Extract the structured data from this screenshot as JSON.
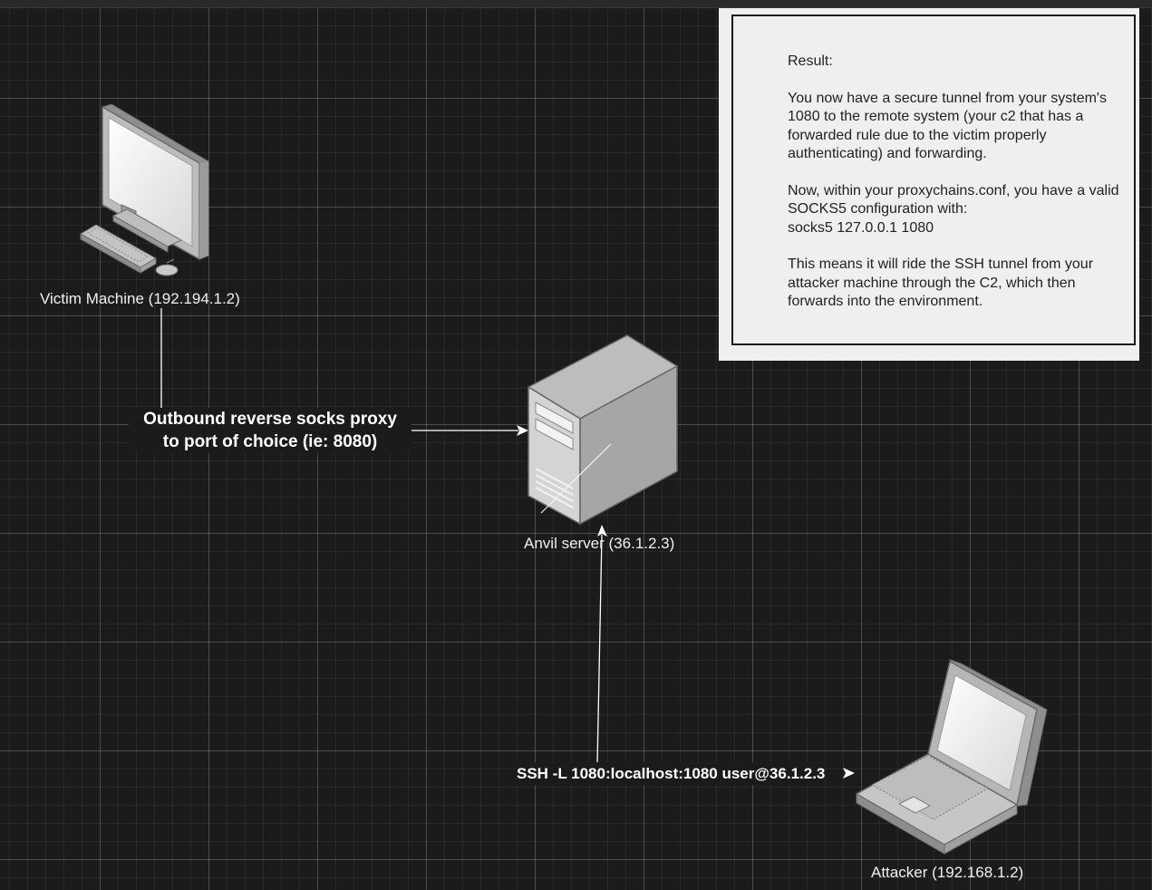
{
  "nodes": {
    "victim": {
      "label": "Victim Machine (192.194.1.2)"
    },
    "server": {
      "label": "Anvil server (36.1.2.3)"
    },
    "attacker": {
      "label": "Attacker (192.168.1.2)"
    }
  },
  "edges": {
    "victim_to_server": {
      "line1": "Outbound reverse socks proxy",
      "line2": "to port of choice (ie: 8080)"
    },
    "attacker_to_server": {
      "label": "SSH -L 1080:localhost:1080 user@36.1.2.3"
    }
  },
  "note": {
    "p1": "Result:",
    "p2": "You now have a secure tunnel from your system's 1080 to the remote system (your c2 that has a forwarded rule due to the victim properly authenticating) and forwarding.",
    "p3_line1": "Now, within your proxychains.conf, you have a valid SOCKS5 configuration with:",
    "p3_line2": "socks5 127.0.0.1 1080",
    "p4": "This means it will ride the SSH tunnel from your attacker machine through the C2, which then forwards into the environment."
  },
  "colors": {
    "background": "#1b1b1b",
    "note": "#efefef",
    "edge": "#ffffff"
  },
  "icons": {
    "victim": "desktop-computer-icon",
    "server": "tower-server-icon",
    "attacker": "laptop-icon"
  }
}
